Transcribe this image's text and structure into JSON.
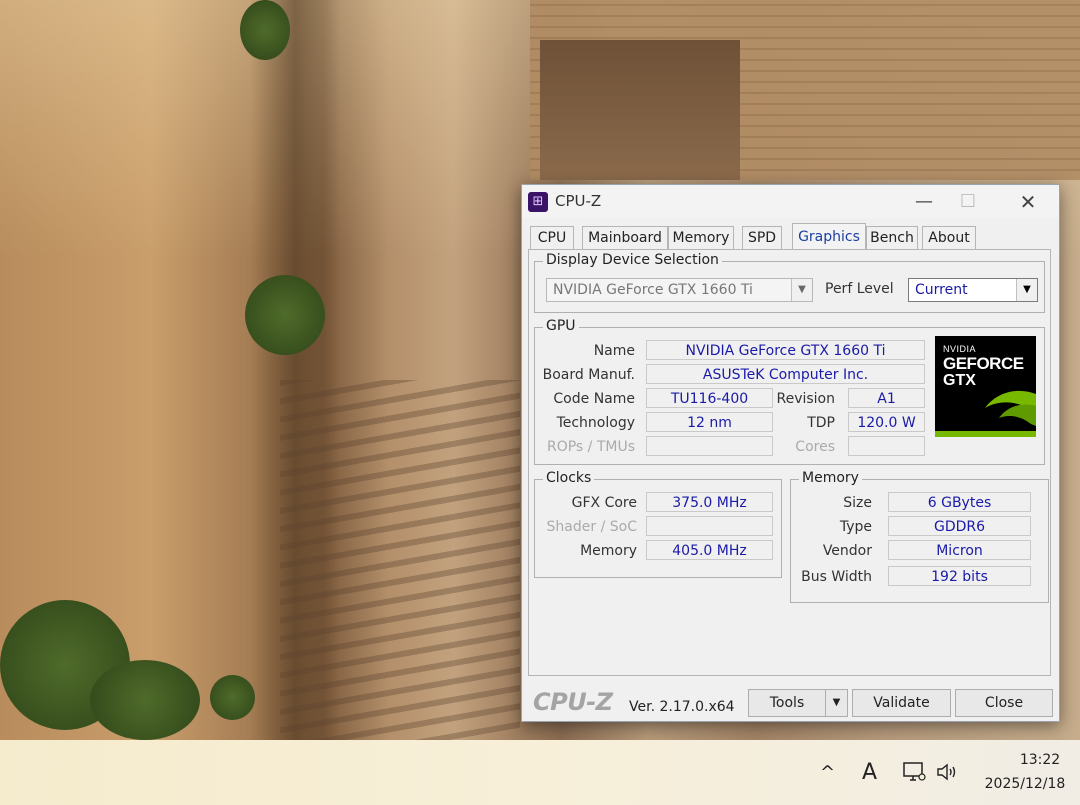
{
  "window": {
    "title": "CPU-Z",
    "icon": "cpuz-chip-icon",
    "controls": {
      "minimize": "—",
      "maximize": "☐",
      "close": "✕"
    }
  },
  "tabs": [
    {
      "label": "CPU"
    },
    {
      "label": "Mainboard"
    },
    {
      "label": "Memory"
    },
    {
      "label": "SPD"
    },
    {
      "label": "Graphics",
      "active": true
    },
    {
      "label": "Bench"
    },
    {
      "label": "About"
    }
  ],
  "display_selection": {
    "group_title": "Display Device Selection",
    "device_value": "NVIDIA GeForce GTX 1660 Ti",
    "perf_label": "Perf Level",
    "perf_value": "Current"
  },
  "gpu": {
    "group_title": "GPU",
    "name_label": "Name",
    "name_value": "NVIDIA GeForce GTX 1660 Ti",
    "board_label": "Board Manuf.",
    "board_value": "ASUSTeK Computer Inc.",
    "code_label": "Code Name",
    "code_value": "TU116-400",
    "revision_label": "Revision",
    "revision_value": "A1",
    "tech_label": "Technology",
    "tech_value": "12 nm",
    "tdp_label": "TDP",
    "tdp_value": "120.0 W",
    "rops_label": "ROPs / TMUs",
    "rops_value": "",
    "cores_label": "Cores",
    "cores_value": "",
    "logo": {
      "brand": "NVIDIA",
      "line1": "GEFORCE",
      "line2": "GTX",
      "accent_color": "#76b900"
    }
  },
  "clocks": {
    "group_title": "Clocks",
    "gfx_label": "GFX Core",
    "gfx_value": "375.0 MHz",
    "shader_label": "Shader / SoC",
    "shader_value": "",
    "memory_label": "Memory",
    "memory_value": "405.0 MHz"
  },
  "memory": {
    "group_title": "Memory",
    "size_label": "Size",
    "size_value": "6 GBytes",
    "type_label": "Type",
    "type_value": "GDDR6",
    "vendor_label": "Vendor",
    "vendor_value": "Micron",
    "bus_label": "Bus Width",
    "bus_value": "192 bits"
  },
  "footer": {
    "logo": "CPU-Z",
    "version": "Ver. 2.17.0.x64",
    "tools_label": "Tools",
    "validate_label": "Validate",
    "close_label": "Close"
  },
  "taskbar": {
    "chevron": "^",
    "ime": "A",
    "time": "13:22",
    "date": "2025/12/18"
  }
}
